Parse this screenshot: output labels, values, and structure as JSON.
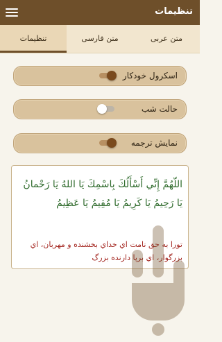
{
  "appbar": {
    "title": "تنظیمات",
    "menu_icon": "hamburger-menu-icon"
  },
  "tabs": [
    {
      "label": "متن عربی",
      "active": false
    },
    {
      "label": "متن فارسی",
      "active": false
    },
    {
      "label": "تنظیمات",
      "active": true
    }
  ],
  "settings": [
    {
      "label": "اسکرول خودکار",
      "on": true
    },
    {
      "label": "حالت شب",
      "on": false
    },
    {
      "label": "نمایش ترجمه",
      "on": true
    }
  ],
  "sample": {
    "arabic": "اللّهُمَّ إِنِّي أَسْأَلُكَ بِاسْمِكَ يَا اللهُ يَا رَحْمانُ يَا رَحِيمُ يَا كَرِيمُ يَا مُقِيمُ يَا عَظِيمُ",
    "persian": "تورا به حق نامت اي خداي بخشنده و مهربان، اي بزرگوار، اي برپا دارنده بزرگ"
  },
  "colors": {
    "appbar": "#6e4f2a",
    "tab_bar": "#f2e6cf",
    "row": "#d9c29d",
    "arabic_text": "#2e6a2b",
    "persian_text": "#a3251f",
    "watermark": "#6e4f2a"
  },
  "watermark_icon": "app-logo-watermark"
}
